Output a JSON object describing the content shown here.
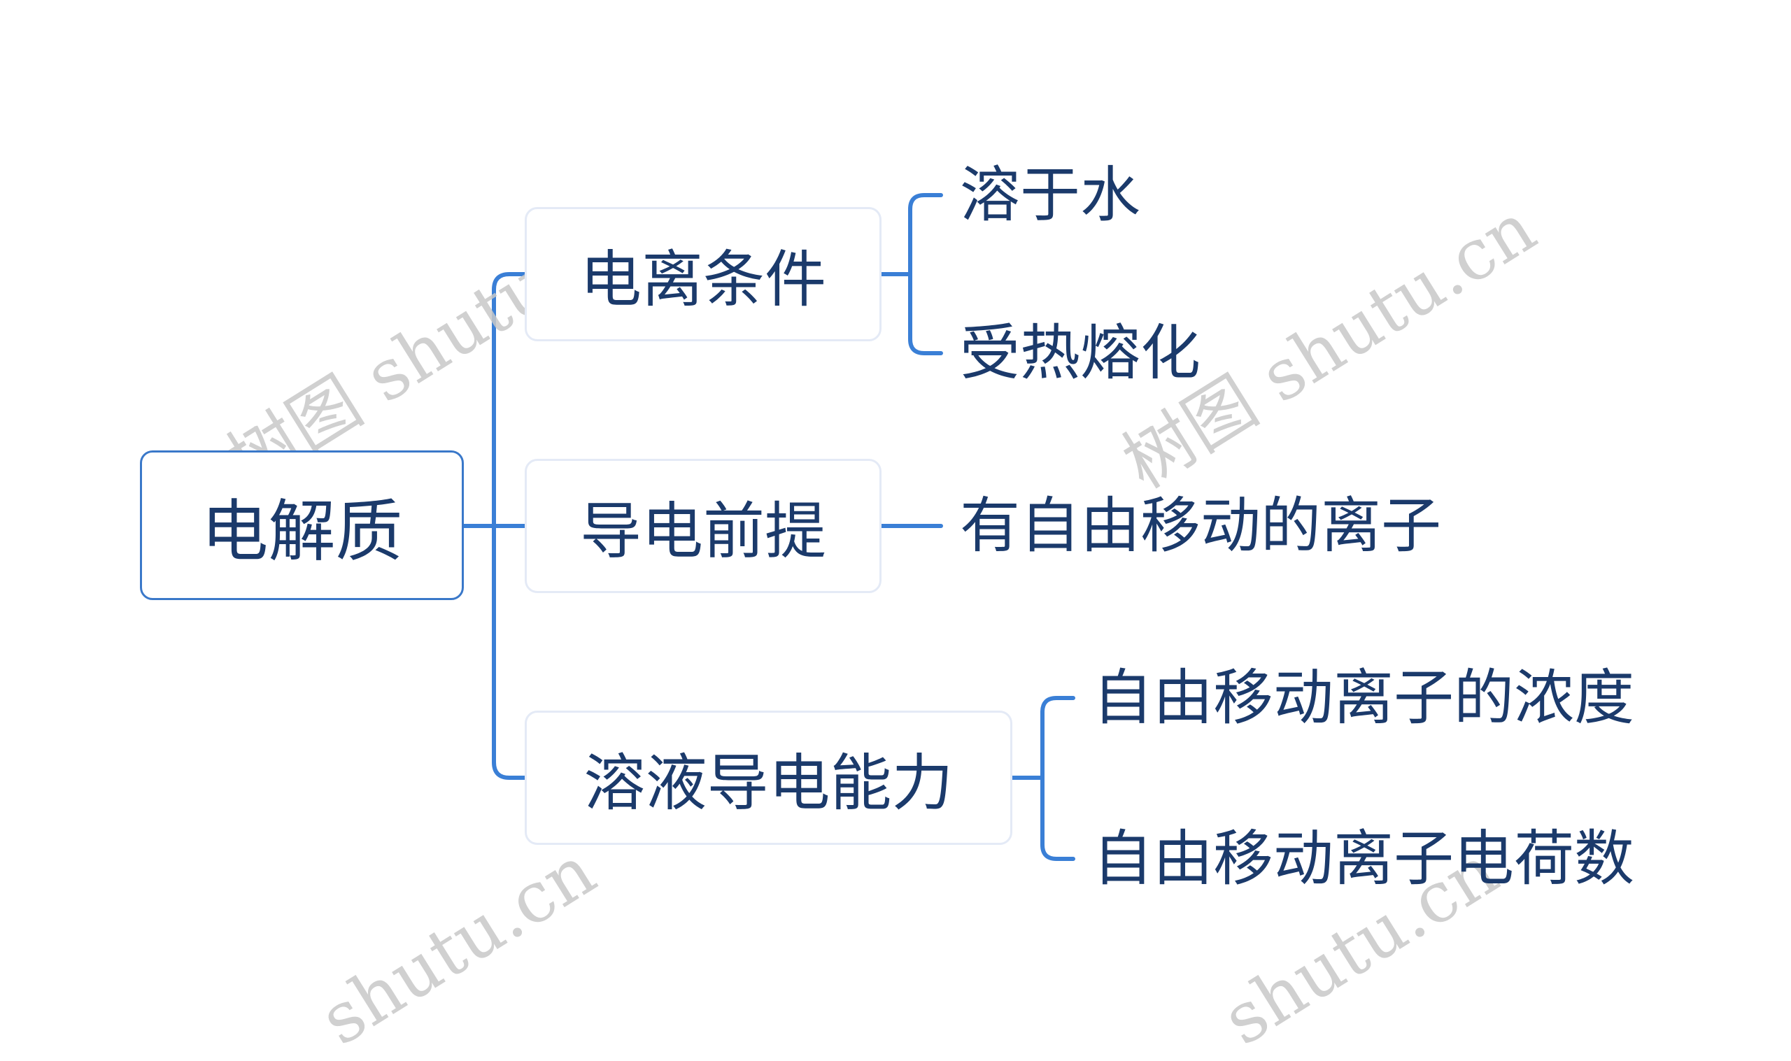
{
  "mindmap": {
    "root": {
      "label": "电解质"
    },
    "branches": [
      {
        "label": "电离条件",
        "children": [
          "溶于水",
          "受热熔化"
        ]
      },
      {
        "label": "导电前提",
        "children": [
          "有自由移动的离子"
        ]
      },
      {
        "label": "溶液导电能力",
        "children": [
          "自由移动离子的浓度",
          "自由移动离子电荷数"
        ]
      }
    ]
  },
  "colors": {
    "connector": "#3a7fd6",
    "text": "#1b3a6b",
    "root_border": "#3a78c9",
    "branch_border": "#e4eaf6",
    "watermark": "#c8c8c8"
  },
  "watermark": {
    "text_full": "树图 shutu.cn",
    "text_partial": "shutu.cn"
  }
}
